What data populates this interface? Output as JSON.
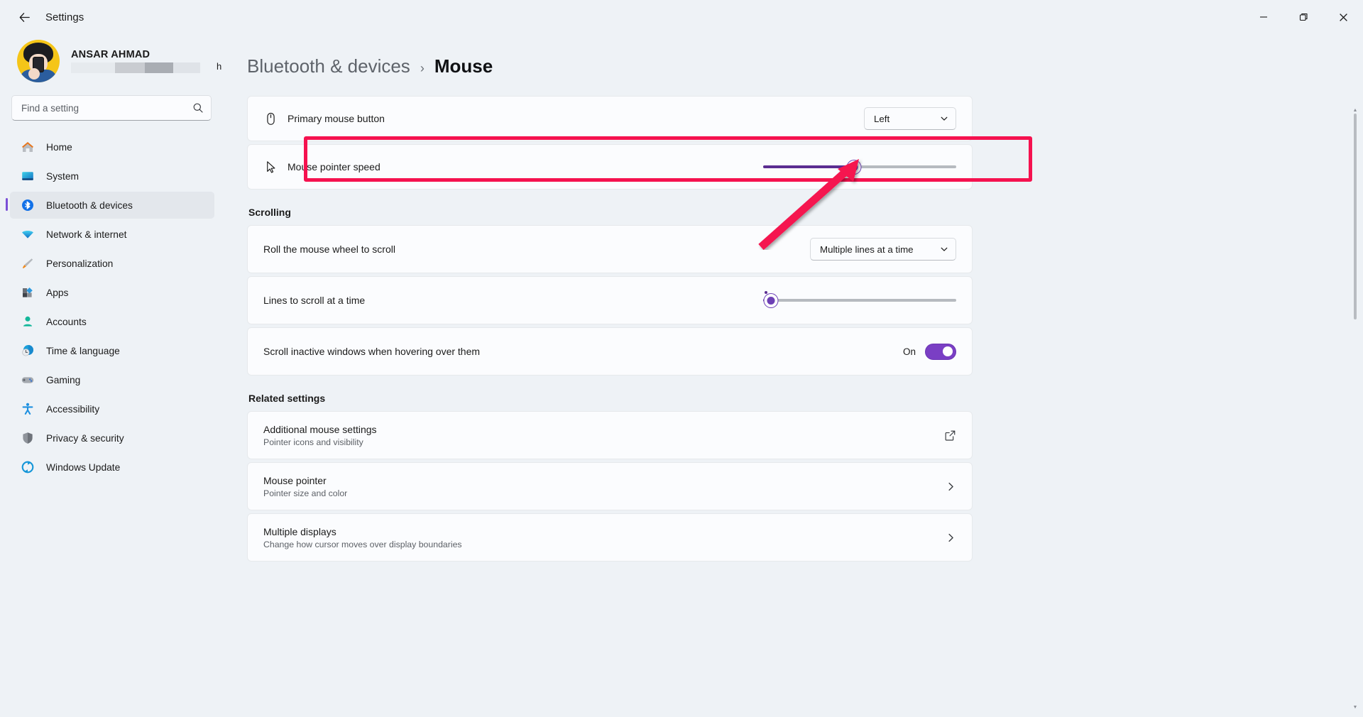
{
  "titlebar": {
    "back_label": "Back",
    "app_title": "Settings",
    "minimize_label": "Minimize",
    "maximize_label": "Restore",
    "close_label": "Close"
  },
  "profile": {
    "name": "ANSAR AHMAD",
    "email_tail": "h"
  },
  "search": {
    "placeholder": "Find a setting",
    "value": ""
  },
  "sidebar": {
    "items": [
      {
        "label": "Home",
        "icon": "home-icon",
        "active": false
      },
      {
        "label": "System",
        "icon": "system-icon",
        "active": false
      },
      {
        "label": "Bluetooth & devices",
        "icon": "bluetooth-icon",
        "active": true
      },
      {
        "label": "Network & internet",
        "icon": "network-icon",
        "active": false
      },
      {
        "label": "Personalization",
        "icon": "personalization-icon",
        "active": false
      },
      {
        "label": "Apps",
        "icon": "apps-icon",
        "active": false
      },
      {
        "label": "Accounts",
        "icon": "accounts-icon",
        "active": false
      },
      {
        "label": "Time & language",
        "icon": "time-language-icon",
        "active": false
      },
      {
        "label": "Gaming",
        "icon": "gaming-icon",
        "active": false
      },
      {
        "label": "Accessibility",
        "icon": "accessibility-icon",
        "active": false
      },
      {
        "label": "Privacy & security",
        "icon": "privacy-security-icon",
        "active": false
      },
      {
        "label": "Windows Update",
        "icon": "windows-update-icon",
        "active": false
      }
    ]
  },
  "breadcrumb": {
    "parent": "Bluetooth & devices",
    "separator": "›",
    "current": "Mouse"
  },
  "main": {
    "primary_mouse_button": {
      "label": "Primary mouse button",
      "value": "Left"
    },
    "mouse_pointer_speed": {
      "label": "Mouse pointer speed",
      "percent": 47
    },
    "scrolling_heading": "Scrolling",
    "roll_wheel": {
      "label": "Roll the mouse wheel to scroll",
      "value": "Multiple lines at a time"
    },
    "lines_to_scroll": {
      "label": "Lines to scroll at a time",
      "percent": 4
    },
    "scroll_inactive": {
      "label": "Scroll inactive windows when hovering over them",
      "state": "On"
    },
    "related_heading": "Related settings",
    "related": [
      {
        "title": "Additional mouse settings",
        "subtitle": "Pointer icons and visibility",
        "action": "external-link-icon"
      },
      {
        "title": "Mouse pointer",
        "subtitle": "Pointer size and color",
        "action": "chevron-right-icon"
      },
      {
        "title": "Multiple displays",
        "subtitle": "Change how cursor moves over display boundaries",
        "action": "chevron-right-icon"
      }
    ]
  },
  "annotation": {
    "highlight_color": "#f5124f",
    "target": "mouse-pointer-speed-slider"
  },
  "colors": {
    "accent": "#7a3fc4",
    "slider_fill": "#5b2d91",
    "window_bg": "#eef2f6",
    "card_bg": "#fbfcfe"
  }
}
